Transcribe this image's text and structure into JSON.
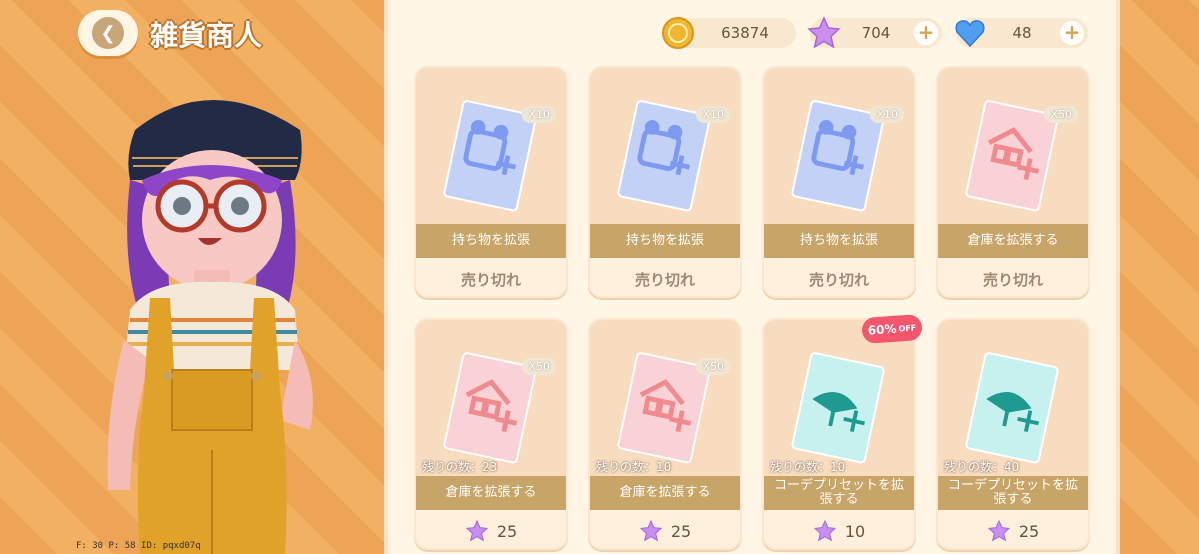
{
  "header": {
    "title": "雑貨商人",
    "back_icon": "chevron-left-icon"
  },
  "debug": {
    "text": "F: 30   P: 58   ID: pqxd07q"
  },
  "currencies": {
    "coins": "63874",
    "stars": "704",
    "gems": "48"
  },
  "colors": {
    "accent": "#c7a468",
    "sale": "#f3566d",
    "background": "#f1ad5e"
  },
  "items": [
    {
      "name": "持ち物を拡張",
      "qty": "X10",
      "status": "売り切れ",
      "art": "bag-plus-icon",
      "color": "#c4d1f7"
    },
    {
      "name": "持ち物を拡張",
      "qty": "X10",
      "status": "売り切れ",
      "art": "bag-plus-icon",
      "color": "#c4d1f7"
    },
    {
      "name": "持ち物を拡張",
      "qty": "X10",
      "status": "売り切れ",
      "art": "bag-plus-icon",
      "color": "#c4d1f7"
    },
    {
      "name": "倉庫を拡張する",
      "qty": "X50",
      "status": "売り切れ",
      "art": "warehouse-plus-icon",
      "color": "#f9d2d7"
    },
    {
      "name": "倉庫を拡張する",
      "qty": "X50",
      "remain": "残りの数：23",
      "price": "25",
      "art": "warehouse-plus-icon",
      "color": "#f9d2d7"
    },
    {
      "name": "倉庫を拡張する",
      "qty": "X50",
      "remain": "残りの数：10",
      "price": "25",
      "art": "warehouse-plus-icon",
      "color": "#f9d2d7"
    },
    {
      "name": "コーデプリセットを拡張する",
      "remain": "残りの数：10",
      "price": "10",
      "art": "outfit-preset-plus-icon",
      "color": "#c6f1ee",
      "sale": "60%",
      "sale_suffix": "OFF"
    },
    {
      "name": "コーデプリセットを拡張する",
      "remain": "残りの数：40",
      "price": "25",
      "art": "outfit-preset-plus-icon",
      "color": "#c6f1ee"
    }
  ]
}
